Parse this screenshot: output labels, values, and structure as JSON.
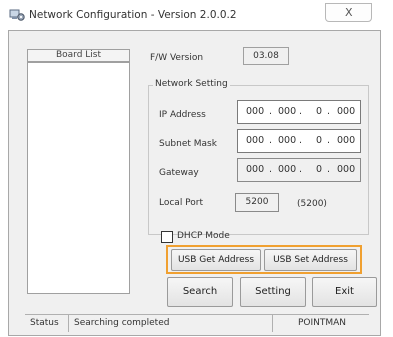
{
  "window": {
    "title": "Network Configuration - Version 2.0.0.2",
    "icon": "network-gear-icon",
    "close_glyph": "X"
  },
  "board_list": {
    "header": "Board List"
  },
  "firmware": {
    "label": "F/W Version",
    "value": "03.08"
  },
  "network_setting": {
    "title": "Network Setting",
    "ip_address": {
      "label": "IP Address",
      "octets": [
        "000",
        "000",
        "0",
        "000"
      ]
    },
    "subnet_mask": {
      "label": "Subnet Mask",
      "octets": [
        "000",
        "000",
        "0",
        "000"
      ]
    },
    "gateway": {
      "label": "Gateway",
      "octets": [
        "000",
        "000",
        "0",
        "000"
      ]
    },
    "local_port": {
      "label": "Local Port",
      "value": "5200",
      "default_hint": "(5200)"
    }
  },
  "dhcp": {
    "label": "DHCP Mode",
    "checked": false
  },
  "buttons": {
    "usb_get": "USB Get Address",
    "usb_set": "USB Set Address",
    "search": "Search",
    "setting": "Setting",
    "exit": "Exit"
  },
  "status_bar": {
    "label": "Status",
    "message": "Searching completed",
    "vendor": "POINTMAN"
  },
  "colors": {
    "highlight": "#f0a030",
    "window_bg": "#f0f0f0"
  }
}
